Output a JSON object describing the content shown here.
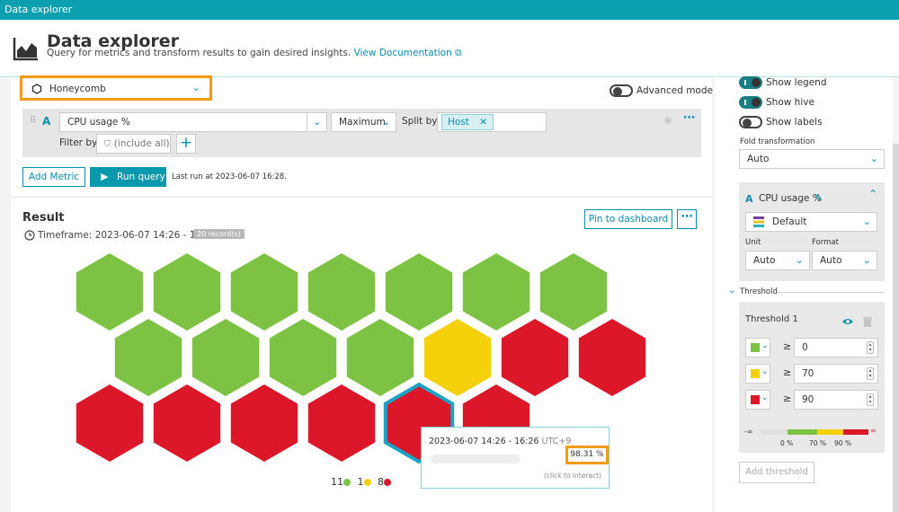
{
  "window_title": "Data explorer",
  "header": {
    "title": "Data explorer",
    "subtitle": "Query for metrics and transform results to gain desired insights.",
    "doc_link": "View Documentation"
  },
  "visualization": {
    "selected": "Honeycomb"
  },
  "advanced_mode": {
    "label": "Advanced mode",
    "on": false
  },
  "query": {
    "letter": "A",
    "metric": "CPU usage %",
    "aggregation": "Maximum",
    "split_by_label": "Split by",
    "split_by_chip": "Host",
    "filter_label": "Filter by",
    "filter_placeholder": "(include all)"
  },
  "actions": {
    "add_metric": "Add Metric",
    "run_query": "Run query",
    "last_run": "Last run at 2023-06-07 16:28."
  },
  "result": {
    "title": "Result",
    "timeframe": "Timeframe: 2023-06-07 14:26 - 16:26",
    "records": "20 record(s)",
    "pin": "Pin to dashboard"
  },
  "colors": {
    "green": "#7dc242",
    "yellow": "#f5d10c",
    "red": "#dc172a",
    "highlight": "#1aa3c7",
    "accent": "#0a8fb0",
    "callout": "#f39c12"
  },
  "honeycomb": [
    [
      "green",
      "green",
      "green",
      "green",
      "green",
      "green",
      "green"
    ],
    [
      "green",
      "green",
      "green",
      "green",
      "yellow",
      "red",
      "red"
    ],
    [
      "red",
      "red",
      "red",
      "red",
      "red",
      "red"
    ]
  ],
  "legend_counts": {
    "green": "11",
    "yellow": "1",
    "red": "8"
  },
  "tooltip": {
    "time": "2023-06-07 14:26 - 16:26",
    "tz": "UTC+9",
    "value": "98.31 %",
    "hint": "(click to interact)"
  },
  "settings": {
    "show_legend": "Show legend",
    "show_hive": "Show hive",
    "show_labels": "Show labels",
    "fold_label": "Fold transformation",
    "fold_value": "Auto",
    "metric_letter": "A",
    "metric_name": "CPU usage %",
    "palette": "Default",
    "unit_label": "Unit",
    "unit_value": "Auto",
    "format_label": "Format",
    "format_value": "Auto",
    "threshold_section": "Threshold",
    "threshold_title": "Threshold 1",
    "rows": [
      {
        "color": "#7dc242",
        "op": "≥",
        "value": "0"
      },
      {
        "color": "#f5d10c",
        "op": "≥",
        "value": "70"
      },
      {
        "color": "#dc172a",
        "op": "≥",
        "value": "90"
      }
    ],
    "scale": {
      "min": "-∞",
      "max": "∞",
      "t1": "0 %",
      "t2": "70 %",
      "t3": "90 %"
    },
    "add_threshold": "Add threshold"
  }
}
